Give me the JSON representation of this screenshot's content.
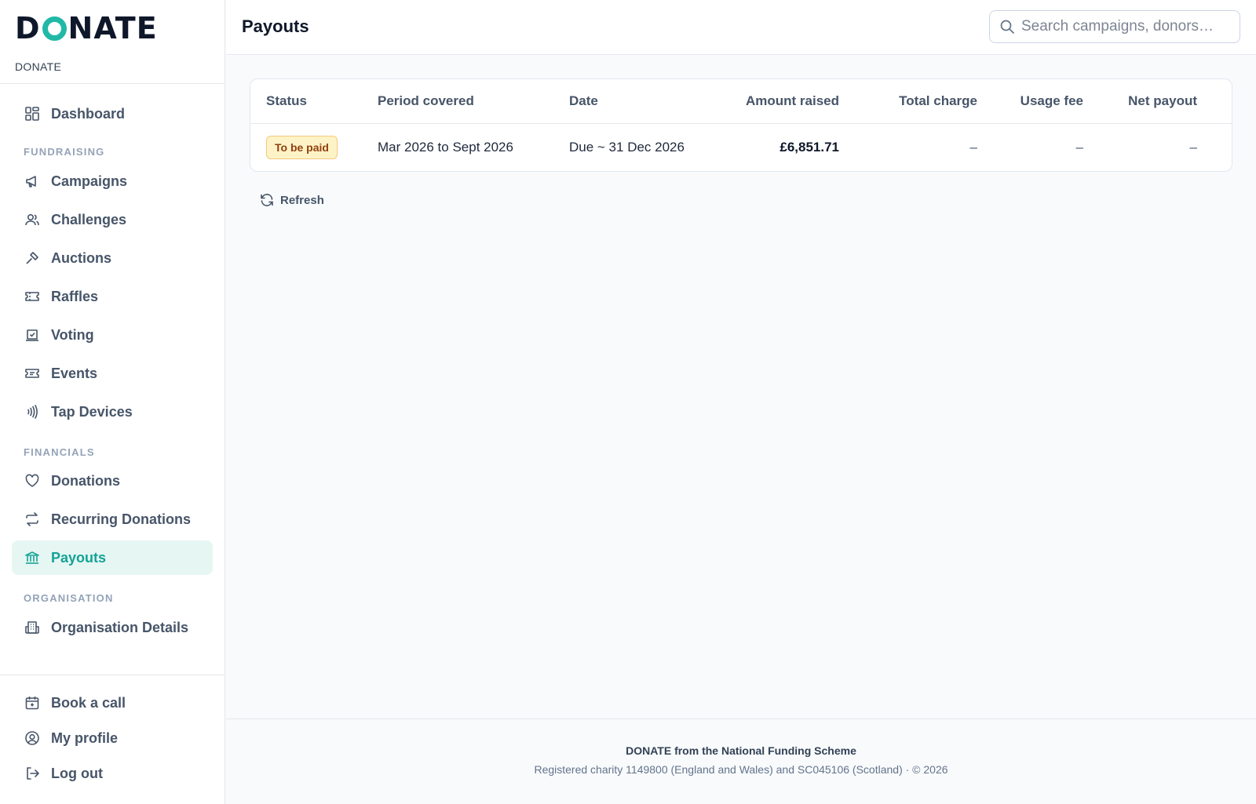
{
  "brand": {
    "logo_pre": "D",
    "logo_post": "NATE",
    "subtitle": "DONATE"
  },
  "sidebar": {
    "dashboard": "Dashboard",
    "section_fundraising": "FUNDRAISING",
    "campaigns": "Campaigns",
    "challenges": "Challenges",
    "auctions": "Auctions",
    "raffles": "Raffles",
    "voting": "Voting",
    "events": "Events",
    "tap_devices": "Tap Devices",
    "section_financials": "FINANCIALS",
    "donations": "Donations",
    "recurring_donations": "Recurring Donations",
    "payouts": "Payouts",
    "section_organisation": "ORGANISATION",
    "organisation_details": "Organisation Details",
    "book_a_call": "Book a call",
    "my_profile": "My profile",
    "log_out": "Log out",
    "active_item": "Payouts"
  },
  "header": {
    "title": "Payouts",
    "search_placeholder": "Search campaigns, donors…"
  },
  "table": {
    "columns": {
      "status": "Status",
      "period": "Period covered",
      "date": "Date",
      "amount": "Amount raised",
      "total_charge": "Total charge",
      "usage_fee": "Usage fee",
      "net_payout": "Net payout"
    },
    "rows": [
      {
        "status": "To be paid",
        "period": "Mar 2026 to Sept 2026",
        "date": "Due ~ 31 Dec 2026",
        "amount": "£6,851.71",
        "total_charge": "–",
        "usage_fee": "–",
        "net_payout": "–"
      }
    ]
  },
  "actions": {
    "refresh": "Refresh"
  },
  "footer": {
    "line1": "DONATE from the National Funding Scheme",
    "line2": "Registered charity 1149800 (England and Wales) and SC045106 (Scotland)  ·  © 2026"
  },
  "colors": {
    "accent": "#14a395",
    "accent_bg": "#e6f6f3",
    "badge_bg": "#fef3c7",
    "badge_text": "#92400e"
  }
}
